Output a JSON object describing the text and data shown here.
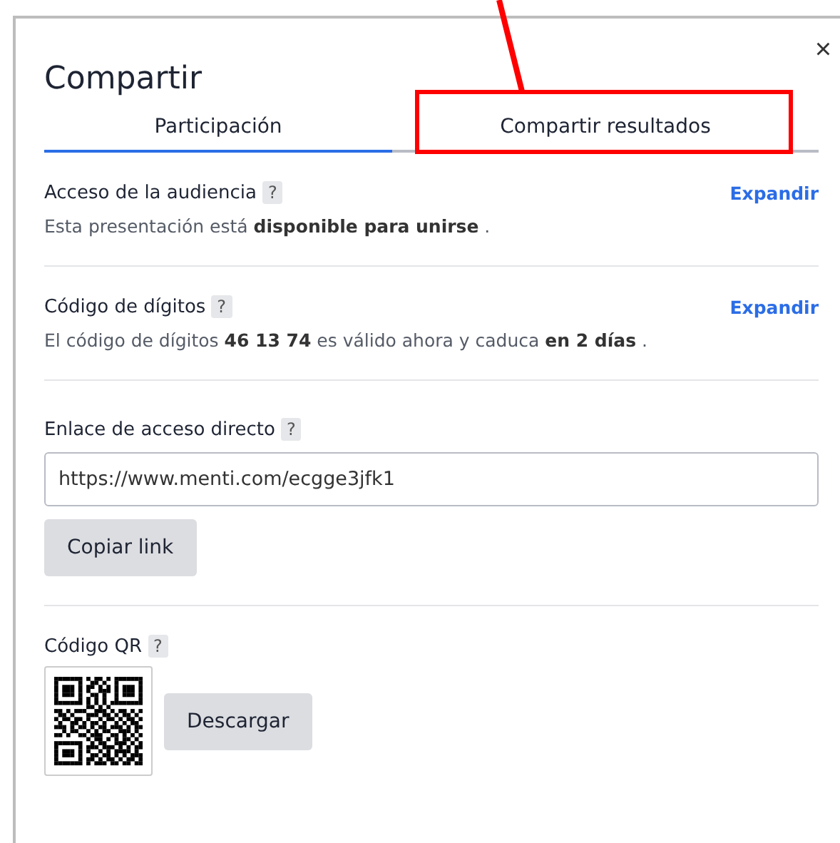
{
  "dialog": {
    "title": "Compartir",
    "close": "×"
  },
  "tabs": [
    {
      "label": "Participación",
      "selected": true,
      "highlighted": false
    },
    {
      "label": "Compartir resultados",
      "selected": false,
      "highlighted": true
    }
  ],
  "sections": [
    {
      "kind": "expandable",
      "heading": "Acceso de la audiencia",
      "help": "?",
      "action": "Expandir",
      "description": "Esta presentación está **disponible para unirse** ."
    },
    {
      "kind": "expandable",
      "heading": "Código de dígitos",
      "help": "?",
      "action": "Expandir",
      "description": "El código de dígitos **46 13 74** es válido ahora y caduca **en 2 días** ."
    },
    {
      "kind": "link",
      "heading": "Enlace de acceso directo",
      "help": "?",
      "value": "https://www.menti.com/ecgge3jfk1",
      "button": "Copiar link"
    },
    {
      "kind": "qr",
      "heading": "Código QR",
      "help": "?",
      "button": "Descargar"
    }
  ]
}
